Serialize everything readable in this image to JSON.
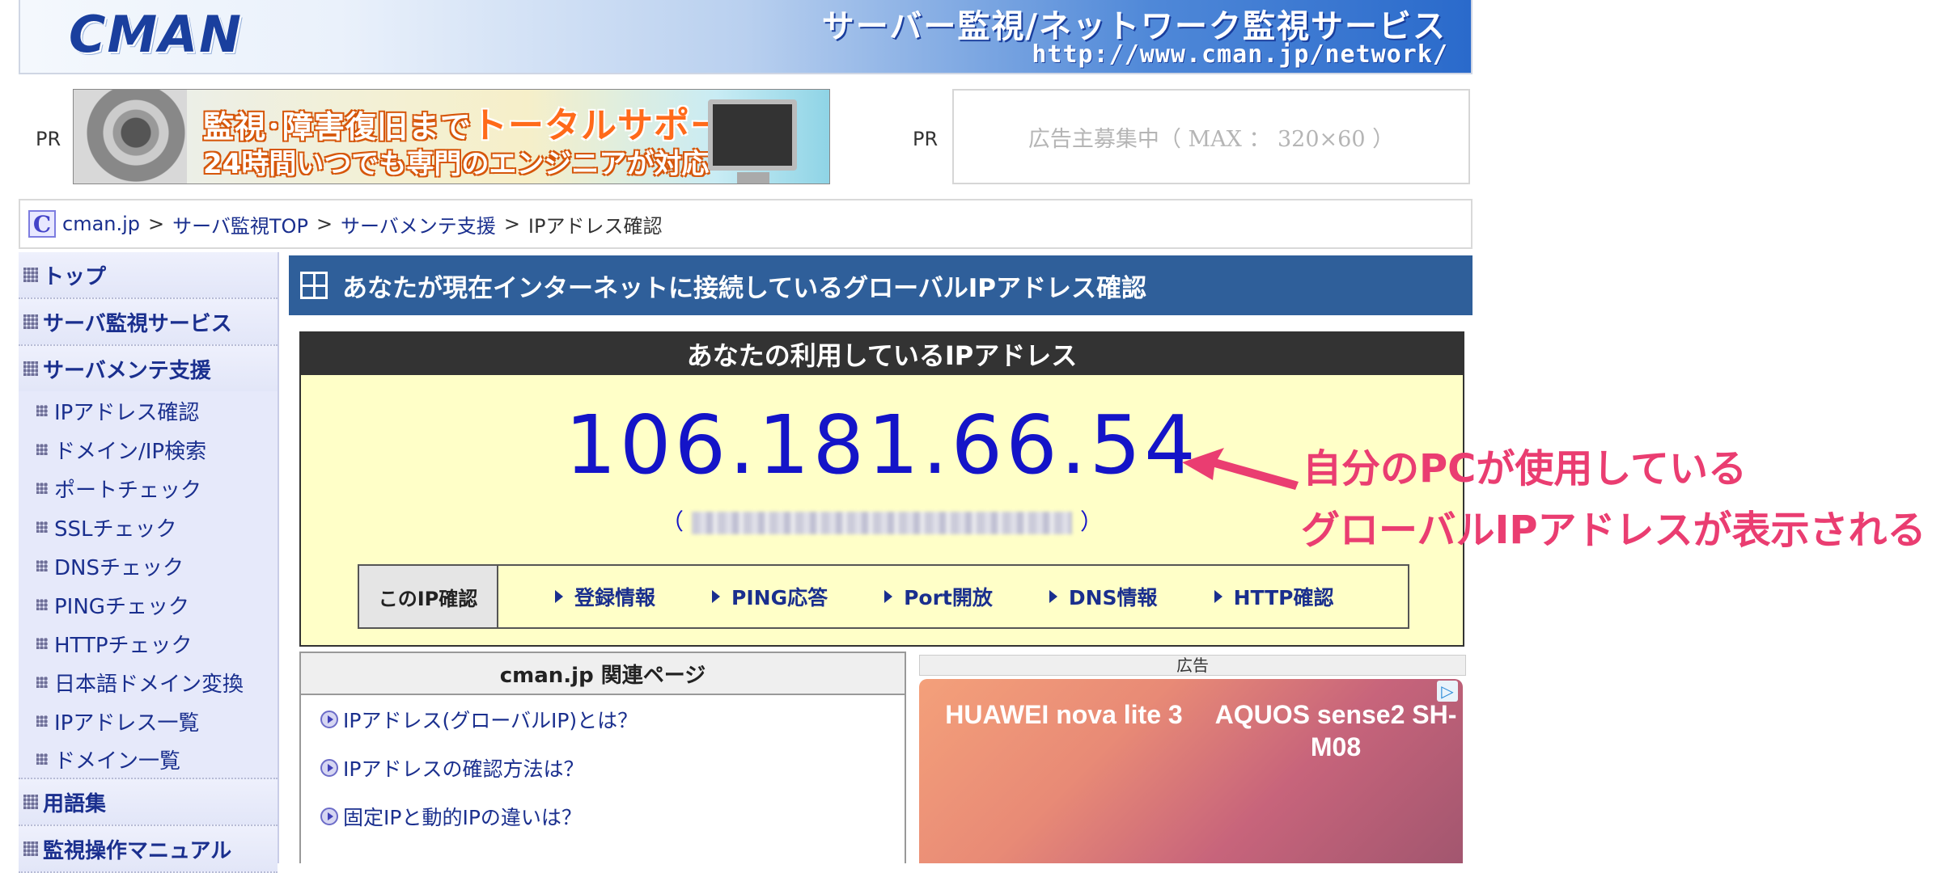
{
  "header": {
    "logo": "CMAN",
    "service_title": "サーバー監視/ネットワーク監視サービス",
    "service_url": "http://www.cman.jp/network/"
  },
  "pr": {
    "label_left": "PR",
    "label_right": "PR",
    "banner_line1_a": "監視･障害復旧まで",
    "banner_line1_b": "トータルサポート",
    "banner_line2_a": "24時間",
    "banner_line2_b": "いつでも専門のエンジニアが対応",
    "ad_placeholder": "広告主募集中（ MAX ： 320×60 ）"
  },
  "breadcrumb": {
    "logo_letter": "C",
    "items": [
      "cman.jp",
      "サーバ監視TOP",
      "サーバメンテ支援",
      "IPアドレス確認"
    ],
    "separator": ">"
  },
  "sidebar": {
    "items": [
      {
        "label": "トップ",
        "level": "top"
      },
      {
        "label": "サーバ監視サービス",
        "level": "top"
      },
      {
        "label": "サーバメンテ支援",
        "level": "top"
      },
      {
        "label": "IPアドレス確認",
        "level": "sub"
      },
      {
        "label": "ドメイン/IP検索",
        "level": "sub"
      },
      {
        "label": "ポートチェック",
        "level": "sub"
      },
      {
        "label": "SSLチェック",
        "level": "sub"
      },
      {
        "label": "DNSチェック",
        "level": "sub"
      },
      {
        "label": "PINGチェック",
        "level": "sub"
      },
      {
        "label": "HTTPチェック",
        "level": "sub"
      },
      {
        "label": "日本語ドメイン変換",
        "level": "sub"
      },
      {
        "label": "IPアドレス一覧",
        "level": "sub"
      },
      {
        "label": "ドメイン一覧",
        "level": "sub"
      },
      {
        "label": "用語集",
        "level": "top"
      },
      {
        "label": "監視操作マニュアル",
        "level": "top"
      }
    ]
  },
  "main": {
    "section_title": "あなたが現在インターネットに接続しているグローバルIPアドレス確認",
    "ip_panel_title": "あなたの利用しているIPアドレス",
    "ip_address": "106.181.66.54",
    "hostname_open": "（",
    "hostname_close": "）",
    "check_label": "このIP確認",
    "check_links": [
      "登録情報",
      "PING応答",
      "Port開放",
      "DNS情報",
      "HTTP確認"
    ]
  },
  "related": {
    "title": "cman.jp 関連ページ",
    "items": [
      "IPアドレス(グローバルIP)とは？",
      "IPアドレスの確認方法は？",
      "固定IPと動的IPの違いは？"
    ]
  },
  "ad": {
    "label": "広告",
    "info_icon": "▷",
    "product1": "HUAWEI nova lite 3",
    "product2": "AQUOS sense2 SH-M08"
  },
  "annotation": {
    "line1": "自分のPCが使用している",
    "line2": "グローバルIPアドレスが表示される",
    "color": "#ea3d71"
  }
}
